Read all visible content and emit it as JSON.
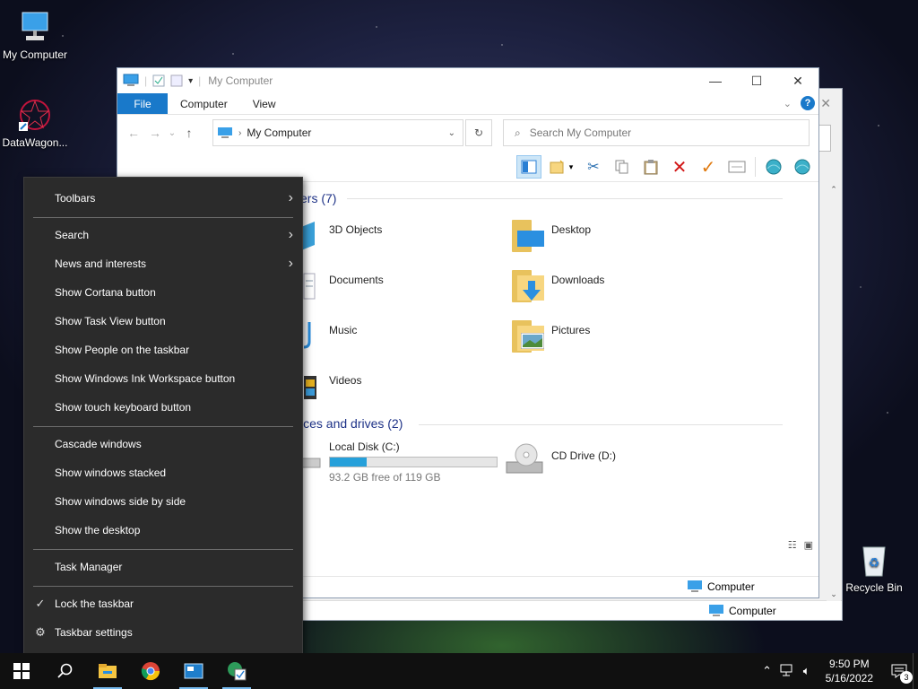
{
  "desktop": {
    "icons": [
      {
        "label": "My Computer"
      },
      {
        "label": "DataWagon..."
      },
      {
        "label": "Recycle Bin"
      }
    ]
  },
  "back_window": {
    "status_location": "Computer"
  },
  "window": {
    "title": "My Computer",
    "tabs": [
      {
        "label": "File"
      },
      {
        "label": "Computer"
      },
      {
        "label": "View"
      }
    ],
    "address": "My Computer",
    "search_placeholder": "Search My Computer",
    "sections": {
      "folders": {
        "header": "ers (7)"
      },
      "devices": {
        "header": "ices and drives (2)"
      }
    },
    "folders": [
      {
        "label": "3D Objects"
      },
      {
        "label": "Desktop"
      },
      {
        "label": "Documents"
      },
      {
        "label": "Downloads"
      },
      {
        "label": "Music"
      },
      {
        "label": "Pictures"
      },
      {
        "label": "Videos"
      }
    ],
    "drives": [
      {
        "label": "Local Disk (C:)",
        "free_text": "93.2 GB free of 119 GB",
        "used_fraction": 0.22
      },
      {
        "label": "CD Drive (D:)"
      }
    ],
    "status_location": "Computer"
  },
  "context_menu": {
    "items": [
      {
        "label": "Toolbars",
        "submenu": true
      },
      {
        "label": "Search",
        "submenu": true
      },
      {
        "label": "News and interests",
        "submenu": true
      },
      {
        "label": "Show Cortana button"
      },
      {
        "label": "Show Task View button"
      },
      {
        "label": "Show People on the taskbar"
      },
      {
        "label": "Show Windows Ink Workspace button"
      },
      {
        "label": "Show touch keyboard button"
      },
      {
        "label": "Cascade windows"
      },
      {
        "label": "Show windows stacked"
      },
      {
        "label": "Show windows side by side"
      },
      {
        "label": "Show the desktop"
      },
      {
        "label": "Task Manager"
      },
      {
        "label": "Lock the taskbar",
        "checked": true
      },
      {
        "label": "Taskbar settings",
        "icon": "gear-icon"
      }
    ]
  },
  "taskbar": {
    "time": "9:50 PM",
    "date": "5/16/2022",
    "notification_count": "3"
  },
  "colors": {
    "accent": "#1979ca",
    "menu_bg": "#2b2b2b",
    "taskbar_bg": "#101010",
    "drive_fill": "#26a0da"
  }
}
